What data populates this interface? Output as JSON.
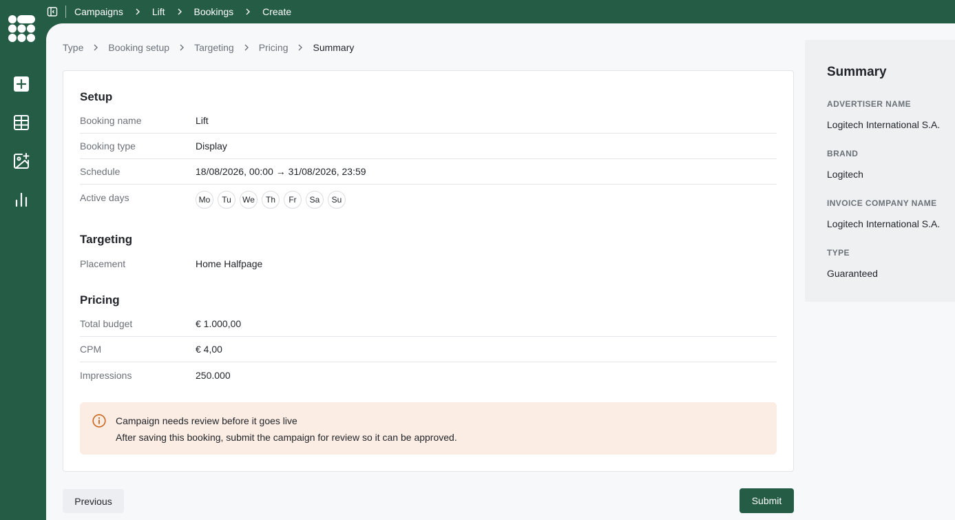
{
  "topbar": {
    "breadcrumbs": [
      "Campaigns",
      "Lift",
      "Bookings",
      "Create"
    ]
  },
  "sidebar": {
    "icons": [
      "plus-square-icon",
      "table-grid-icon",
      "image-add-icon",
      "bar-chart-icon"
    ]
  },
  "steps": [
    "Type",
    "Booking setup",
    "Targeting",
    "Pricing",
    "Summary"
  ],
  "setup": {
    "title": "Setup",
    "rows": [
      {
        "label": "Booking name",
        "value": "Lift"
      },
      {
        "label": "Booking type",
        "value": "Display"
      },
      {
        "label": "Schedule",
        "value": "18/08/2026, 00:00 → 31/08/2026, 23:59"
      },
      {
        "label": "Active days"
      }
    ],
    "days": [
      "Mo",
      "Tu",
      "We",
      "Th",
      "Fr",
      "Sa",
      "Su"
    ]
  },
  "targeting": {
    "title": "Targeting",
    "rows": [
      {
        "label": "Placement",
        "value": "Home Halfpage"
      }
    ]
  },
  "pricing": {
    "title": "Pricing",
    "rows": [
      {
        "label": "Total budget",
        "value": "€ 1.000,00"
      },
      {
        "label": "CPM",
        "value": "€ 4,00"
      },
      {
        "label": "Impressions",
        "value": "250.000"
      }
    ]
  },
  "alert": {
    "title": "Campaign needs review before it goes live",
    "text": "After saving this booking, submit the campaign for review so it can be approved."
  },
  "buttons": {
    "previous": "Previous",
    "submit": "Submit"
  },
  "summary": {
    "title": "Summary",
    "fields": [
      {
        "label": "ADVERTISER NAME",
        "value": "Logitech International S.A."
      },
      {
        "label": "BRAND",
        "value": "Logitech"
      },
      {
        "label": "INVOICE COMPANY NAME",
        "value": "Logitech International S.A."
      },
      {
        "label": "TYPE",
        "value": "Guaranteed"
      }
    ]
  },
  "colors": {
    "brand": "#245c45",
    "alert_bg": "#fcede4",
    "alert_icon": "#c8651b"
  }
}
